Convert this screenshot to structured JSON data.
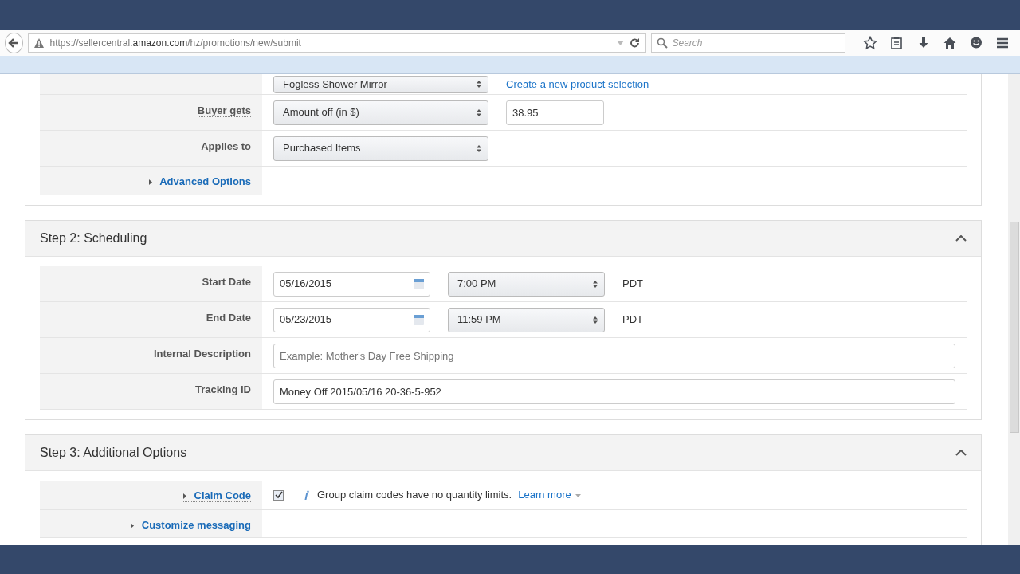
{
  "browser": {
    "url_host_prefix": "https://sellercentral.",
    "url_host": "amazon.com",
    "url_path": "/hz/promotions/new/submit",
    "search_placeholder": "Search"
  },
  "sections": [
    {
      "rows": [
        {
          "kind": "select",
          "label": null,
          "value": "Fogless Shower Mirror",
          "link": "Create a new product selection"
        },
        {
          "kind": "select",
          "label": "Buyer gets",
          "underlined": true,
          "value": "Amount off (in $)",
          "input": "38.95"
        },
        {
          "kind": "select",
          "label": "Applies to",
          "underlined": false,
          "value": "Purchased Items"
        },
        {
          "kind": "toggle",
          "label": "Advanced Options",
          "underlined": false
        }
      ]
    },
    {
      "title": "Step 2: Scheduling",
      "expanded": true,
      "rows": [
        {
          "kind": "date",
          "label": "Start Date",
          "underlined": false,
          "date": "05/16/2015",
          "time": "7:00 PM",
          "zone": "PDT"
        },
        {
          "kind": "date",
          "label": "End Date",
          "underlined": false,
          "date": "05/23/2015",
          "time": "11:59 PM",
          "zone": "PDT"
        },
        {
          "kind": "text",
          "label": "Internal Description",
          "underlined": true,
          "placeholder": "Example: Mother's Day Free Shipping"
        },
        {
          "kind": "text",
          "label": "Tracking ID",
          "underlined": false,
          "value": "Money Off 2015/05/16 20-36-5-952"
        }
      ]
    },
    {
      "title": "Step 3: Additional Options",
      "expanded": true,
      "rows": [
        {
          "kind": "check",
          "label": "Claim Code",
          "underlined": true,
          "checked": true,
          "info": "Group claim codes have no quantity limits.",
          "link": "Learn more"
        },
        {
          "kind": "toggle",
          "label": "Customize messaging",
          "underlined": false
        }
      ]
    }
  ]
}
